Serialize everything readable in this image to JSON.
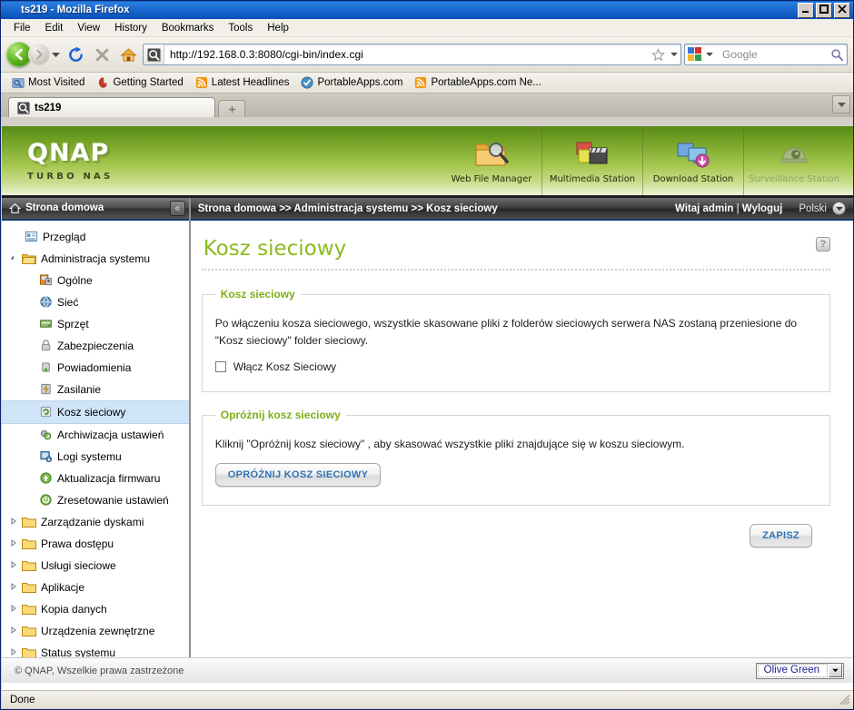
{
  "window": {
    "title": "ts219 - Mozilla Firefox",
    "minimize_label": "Minimize",
    "maximize_label": "Maximize",
    "close_label": "Close"
  },
  "menubar": [
    {
      "label": "File",
      "accel": "F"
    },
    {
      "label": "Edit",
      "accel": "E"
    },
    {
      "label": "View",
      "accel": "V"
    },
    {
      "label": "History",
      "accel": "s"
    },
    {
      "label": "Bookmarks",
      "accel": "B"
    },
    {
      "label": "Tools",
      "accel": "T"
    },
    {
      "label": "Help",
      "accel": "H"
    }
  ],
  "navbar": {
    "url": "http://192.168.0.3:8080/cgi-bin/index.cgi",
    "search_placeholder": "Google",
    "back_label": "Back",
    "forward_label": "Forward",
    "reload_label": "Reload",
    "stop_label": "Stop",
    "home_label": "Home"
  },
  "bookmarks": [
    {
      "label": "Most Visited",
      "icon": "folder-star-icon"
    },
    {
      "label": "Getting Started",
      "icon": "firefox-flame-icon"
    },
    {
      "label": "Latest Headlines",
      "icon": "rss-icon"
    },
    {
      "label": "PortableApps.com",
      "icon": "check-circle-icon"
    },
    {
      "label": "PortableApps.com Ne...",
      "icon": "rss-icon"
    }
  ],
  "tabs": {
    "items": [
      {
        "label": "ts219"
      }
    ],
    "new_tab_label": "+",
    "list_all_label": "List all tabs"
  },
  "qnap": {
    "brand": "QNAP",
    "tagline": "TURBO NAS",
    "stations": [
      {
        "label": "Web File Manager",
        "icon": "folder-search-icon",
        "disabled": false
      },
      {
        "label": "Multimedia Station",
        "icon": "photo-clapper-icon",
        "disabled": false
      },
      {
        "label": "Download Station",
        "icon": "monitor-download-icon",
        "disabled": false
      },
      {
        "label": "Surveillance Station",
        "icon": "dome-camera-icon",
        "disabled": true
      }
    ]
  },
  "sidebar": {
    "header": "Strona domowa",
    "collapse_label": "«",
    "items": [
      {
        "label": "Przegląd",
        "level": 1,
        "icon": "overview-icon",
        "twisty": "",
        "selected": false
      },
      {
        "label": "Administracja systemu",
        "level": 0,
        "icon": "folder-open-icon",
        "twisty": "▲",
        "selected": false
      },
      {
        "label": "Ogólne",
        "level": 2,
        "icon": "general-icon",
        "twisty": "",
        "selected": false
      },
      {
        "label": "Sieć",
        "level": 2,
        "icon": "network-icon",
        "twisty": "",
        "selected": false
      },
      {
        "label": "Sprzęt",
        "level": 2,
        "icon": "hardware-icon",
        "twisty": "",
        "selected": false
      },
      {
        "label": "Zabezpieczenia",
        "level": 2,
        "icon": "security-lock-icon",
        "twisty": "",
        "selected": false
      },
      {
        "label": "Powiadomienia",
        "level": 2,
        "icon": "notification-icon",
        "twisty": "",
        "selected": false
      },
      {
        "label": "Zasilanie",
        "level": 2,
        "icon": "power-icon",
        "twisty": "",
        "selected": false
      },
      {
        "label": "Kosz sieciowy",
        "level": 2,
        "icon": "recycle-bin-icon",
        "twisty": "",
        "selected": true
      },
      {
        "label": "Archiwizacja ustawień",
        "level": 2,
        "icon": "backup-icon",
        "twisty": "",
        "selected": false
      },
      {
        "label": "Logi systemu",
        "level": 2,
        "icon": "system-logs-icon",
        "twisty": "",
        "selected": false
      },
      {
        "label": "Aktualizacja firmwaru",
        "level": 2,
        "icon": "firmware-update-icon",
        "twisty": "",
        "selected": false
      },
      {
        "label": "Zresetowanie ustawień",
        "level": 2,
        "icon": "reset-icon",
        "twisty": "",
        "selected": false
      },
      {
        "label": "Zarządzanie dyskami",
        "level": 0,
        "icon": "folder-icon",
        "twisty": "▷",
        "selected": false
      },
      {
        "label": "Prawa dostępu",
        "level": 0,
        "icon": "folder-icon",
        "twisty": "▷",
        "selected": false
      },
      {
        "label": "Usługi sieciowe",
        "level": 0,
        "icon": "folder-icon",
        "twisty": "▷",
        "selected": false
      },
      {
        "label": "Aplikacje",
        "level": 0,
        "icon": "folder-icon",
        "twisty": "▷",
        "selected": false
      },
      {
        "label": "Kopia danych",
        "level": 0,
        "icon": "folder-icon",
        "twisty": "▷",
        "selected": false
      },
      {
        "label": "Urządzenia zewnętrzne",
        "level": 0,
        "icon": "folder-icon",
        "twisty": "▷",
        "selected": false
      },
      {
        "label": "Status systemu",
        "level": 0,
        "icon": "folder-icon",
        "twisty": "▷",
        "selected": false
      }
    ]
  },
  "topbar": {
    "breadcrumb": "Strona domowa >> Administracja systemu >> Kosz sieciowy",
    "welcome": "Witaj admin",
    "separator": " | ",
    "logout": "Wyloguj",
    "language": "Polski"
  },
  "page": {
    "title": "Kosz sieciowy",
    "help_label": "?",
    "section1": {
      "legend": "Kosz sieciowy",
      "description": "Po włączeniu kosza sieciowego, wszystkie skasowane pliki z folderów sieciowych serwera NAS zostaną przeniesione do \"Kosz sieciowy\" folder sieciowy.",
      "checkbox_label": "Włącz Kosz Sieciowy",
      "checkbox_checked": false
    },
    "section2": {
      "legend": "Opróżnij kosz sieciowy",
      "description": "Kliknij \"Opróżnij kosz sieciowy\" , aby skasować wszystkie pliki znajdujące się w koszu sieciowym.",
      "button_label": "OPRÓŻNIJ KOSZ SIECIOWY"
    },
    "save_label": "ZAPISZ"
  },
  "page_footer": {
    "copyright": "© QNAP, Wszelkie prawa zastrzeżone",
    "theme": "Olive Green"
  },
  "statusbar": {
    "text": "Done"
  },
  "colors": {
    "brand_green": "#8cbb1f",
    "legend_green": "#7fae17",
    "button_blue": "#2f73b5",
    "selection_blue": "#cfe4f7",
    "titlebar_blue": "#1c6dd4"
  }
}
